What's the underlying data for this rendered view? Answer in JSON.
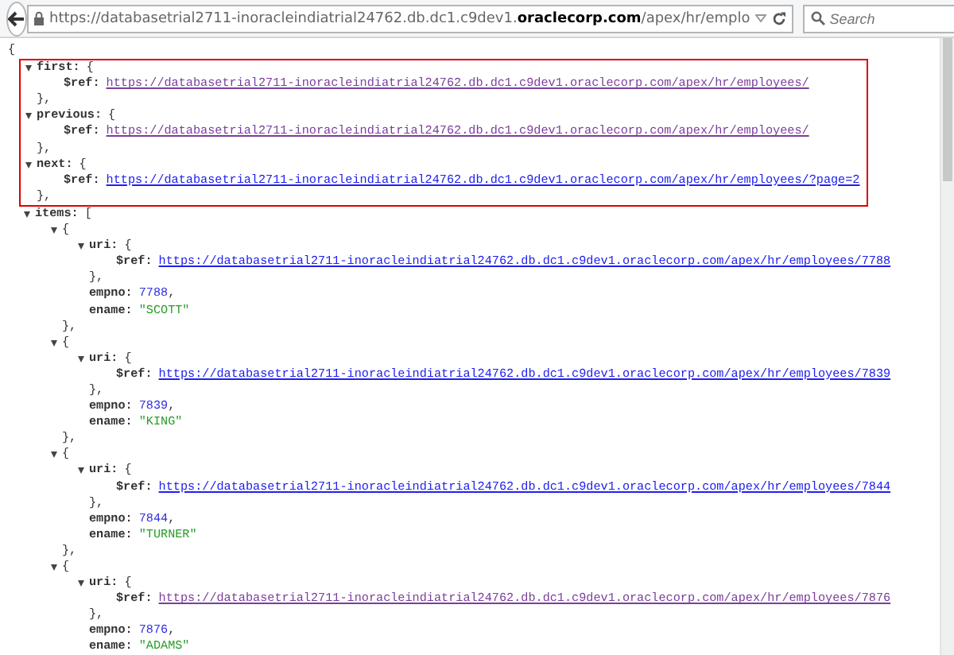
{
  "toolbar": {
    "url": "https://databasetrial2711-inoracleindiatrial24762.db.dc1.c9dev1.**oraclecorp.com**/apex/hr/emplo",
    "search": {
      "placeholder": "Search"
    }
  },
  "document": {
    "open": "{",
    "children": [
      {
        "kind": "highlight",
        "children": [
          {
            "kind": "object",
            "key": "first:",
            "open": "{",
            "expanded": true,
            "close": "},",
            "children": [
              {
                "kind": "link",
                "key": "$ref:",
                "value": "https://databasetrial2711-inoracleindiatrial24762.db.dc1.c9dev1.oraclecorp.com/apex/hr/employees/",
                "visited": true
              }
            ]
          },
          {
            "kind": "object",
            "key": "previous:",
            "open": "{",
            "expanded": true,
            "close": "},",
            "children": [
              {
                "kind": "link",
                "key": "$ref:",
                "value": "https://databasetrial2711-inoracleindiatrial24762.db.dc1.c9dev1.oraclecorp.com/apex/hr/employees/",
                "visited": true
              }
            ]
          },
          {
            "kind": "object",
            "key": "next:",
            "open": "{",
            "expanded": true,
            "close": "},",
            "children": [
              {
                "kind": "link",
                "key": "$ref:",
                "value": "https://databasetrial2711-inoracleindiatrial24762.db.dc1.c9dev1.oraclecorp.com/apex/hr/employees/?page=2",
                "visited": false
              }
            ]
          }
        ]
      },
      {
        "kind": "object",
        "key": "items:",
        "open": "[",
        "expanded": true,
        "children": [
          {
            "kind": "object",
            "open": "{",
            "expanded": true,
            "close": "},",
            "children": [
              {
                "kind": "object",
                "key": "uri:",
                "open": "{",
                "expanded": true,
                "close": "},",
                "children": [
                  {
                    "kind": "link",
                    "key": "$ref:",
                    "value": "https://databasetrial2711-inoracleindiatrial24762.db.dc1.c9dev1.oraclecorp.com/apex/hr/employees/7788",
                    "visited": false
                  }
                ]
              },
              {
                "kind": "number",
                "key": "empno:",
                "value": "7788",
                "suffix": ","
              },
              {
                "kind": "string",
                "key": "ename:",
                "value": "\"SCOTT\""
              }
            ]
          },
          {
            "kind": "object",
            "open": "{",
            "expanded": true,
            "close": "},",
            "children": [
              {
                "kind": "object",
                "key": "uri:",
                "open": "{",
                "expanded": true,
                "close": "},",
                "children": [
                  {
                    "kind": "link",
                    "key": "$ref:",
                    "value": "https://databasetrial2711-inoracleindiatrial24762.db.dc1.c9dev1.oraclecorp.com/apex/hr/employees/7839",
                    "visited": false
                  }
                ]
              },
              {
                "kind": "number",
                "key": "empno:",
                "value": "7839",
                "suffix": ","
              },
              {
                "kind": "string",
                "key": "ename:",
                "value": "\"KING\""
              }
            ]
          },
          {
            "kind": "object",
            "open": "{",
            "expanded": true,
            "close": "},",
            "children": [
              {
                "kind": "object",
                "key": "uri:",
                "open": "{",
                "expanded": true,
                "close": "},",
                "children": [
                  {
                    "kind": "link",
                    "key": "$ref:",
                    "value": "https://databasetrial2711-inoracleindiatrial24762.db.dc1.c9dev1.oraclecorp.com/apex/hr/employees/7844",
                    "visited": false
                  }
                ]
              },
              {
                "kind": "number",
                "key": "empno:",
                "value": "7844",
                "suffix": ","
              },
              {
                "kind": "string",
                "key": "ename:",
                "value": "\"TURNER\""
              }
            ]
          },
          {
            "kind": "object",
            "open": "{",
            "expanded": true,
            "children": [
              {
                "kind": "object",
                "key": "uri:",
                "open": "{",
                "expanded": true,
                "close": "},",
                "children": [
                  {
                    "kind": "link",
                    "key": "$ref:",
                    "value": "https://databasetrial2711-inoracleindiatrial24762.db.dc1.c9dev1.oraclecorp.com/apex/hr/employees/7876",
                    "visited": true
                  }
                ]
              },
              {
                "kind": "number",
                "key": "empno:",
                "value": "7876",
                "suffix": ","
              },
              {
                "kind": "string",
                "key": "ename:",
                "value": "\"ADAMS\""
              }
            ]
          }
        ]
      }
    ]
  }
}
